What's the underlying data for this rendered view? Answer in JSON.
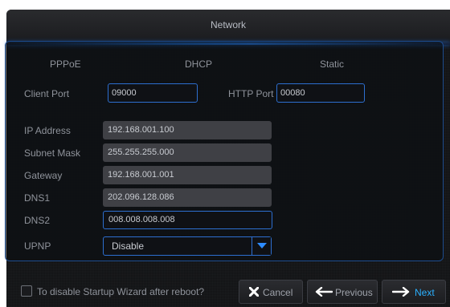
{
  "window": {
    "title": "Network"
  },
  "modes": {
    "pppoe": "PPPoE",
    "dhcp": "DHCP",
    "static": "Static"
  },
  "ports": {
    "client_label": "Client Port",
    "client_value": "09000",
    "http_label": "HTTP Port",
    "http_value": "00080"
  },
  "fields": {
    "ip_label": "IP Address",
    "ip_value": "192.168.001.100",
    "subnet_label": "Subnet Mask",
    "subnet_value": "255.255.255.000",
    "gateway_label": "Gateway",
    "gateway_value": "192.168.001.001",
    "dns1_label": "DNS1",
    "dns1_value": "202.096.128.086",
    "dns2_label": "DNS2",
    "dns2_value": "008.008.008.008",
    "upnp_label": "UPNP",
    "upnp_value": "Disable"
  },
  "footer": {
    "checkbox_label": "To disable Startup Wizard after reboot?",
    "cancel_label": "Cancel",
    "previous_label": "Previous",
    "next_label": "Next"
  },
  "colors": {
    "accent": "#2d6fd0",
    "next_text": "#2ab0ff",
    "background": "#111214"
  },
  "icons": {
    "cancel": "x-icon",
    "previous": "arrow-left-icon",
    "next": "arrow-right-icon",
    "dropdown": "chevron-down-icon"
  }
}
